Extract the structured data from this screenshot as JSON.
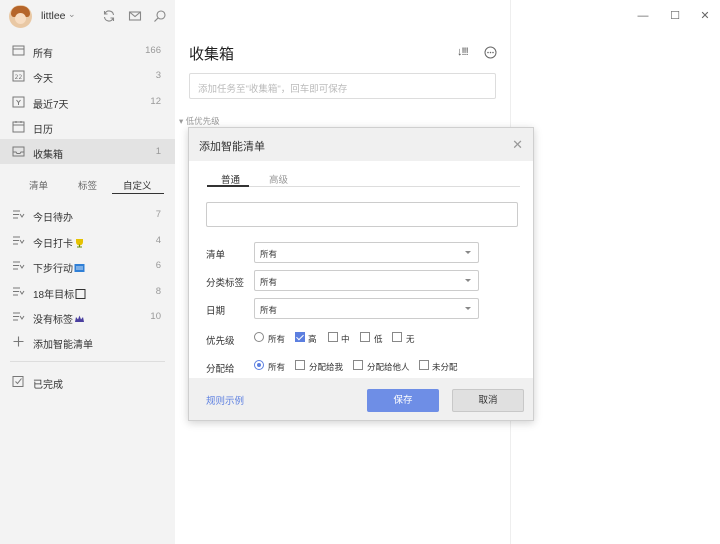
{
  "user": {
    "name": "littlee"
  },
  "sidebar": {
    "items": [
      {
        "label": "所有",
        "count": "166",
        "icon": "all-icon"
      },
      {
        "label": "今天",
        "count": "3",
        "icon": "calendar-day-icon"
      },
      {
        "label": "最近7天",
        "count": "12",
        "icon": "calendar-week-icon"
      },
      {
        "label": "日历",
        "count": "",
        "icon": "calendar-icon"
      },
      {
        "label": "收集箱",
        "count": "1",
        "icon": "inbox-icon"
      }
    ],
    "tabs": [
      "清单",
      "标签",
      "自定义"
    ],
    "smart_lists": [
      {
        "label": "今日待办",
        "count": "7"
      },
      {
        "label": "今日打卡",
        "count": "4",
        "emoji": "trophy"
      },
      {
        "label": "下步行动",
        "count": "6",
        "emoji": "blue-box"
      },
      {
        "label": "18年目标",
        "count": "8",
        "emoji": "square"
      },
      {
        "label": "没有标签",
        "count": "10",
        "emoji": "crown"
      }
    ],
    "add_smart_list": "添加智能清单",
    "completed": "已完成"
  },
  "main": {
    "title": "收集箱",
    "add_placeholder": "添加任务至\"收集箱\"，回车即可保存",
    "group_label": "低优先级"
  },
  "dialog": {
    "title": "添加智能清单",
    "tabs": [
      "普通",
      "高级"
    ],
    "name_value": "",
    "fields": {
      "list": {
        "label": "清单",
        "value": "所有"
      },
      "tag": {
        "label": "分类标签",
        "value": "所有"
      },
      "date": {
        "label": "日期",
        "value": "所有"
      },
      "priority": {
        "label": "优先级",
        "options": [
          "所有",
          "高",
          "中",
          "低",
          "无"
        ]
      },
      "assign": {
        "label": "分配给",
        "options": [
          "所有",
          "分配给我",
          "分配给他人",
          "未分配"
        ]
      }
    },
    "rule_link": "规则示例",
    "save": "保存",
    "cancel": "取消"
  },
  "colors": {
    "accent": "#5c7fe0",
    "sidebar_bg": "#f3f3f3",
    "dialog_header": "#f0f0f0"
  }
}
